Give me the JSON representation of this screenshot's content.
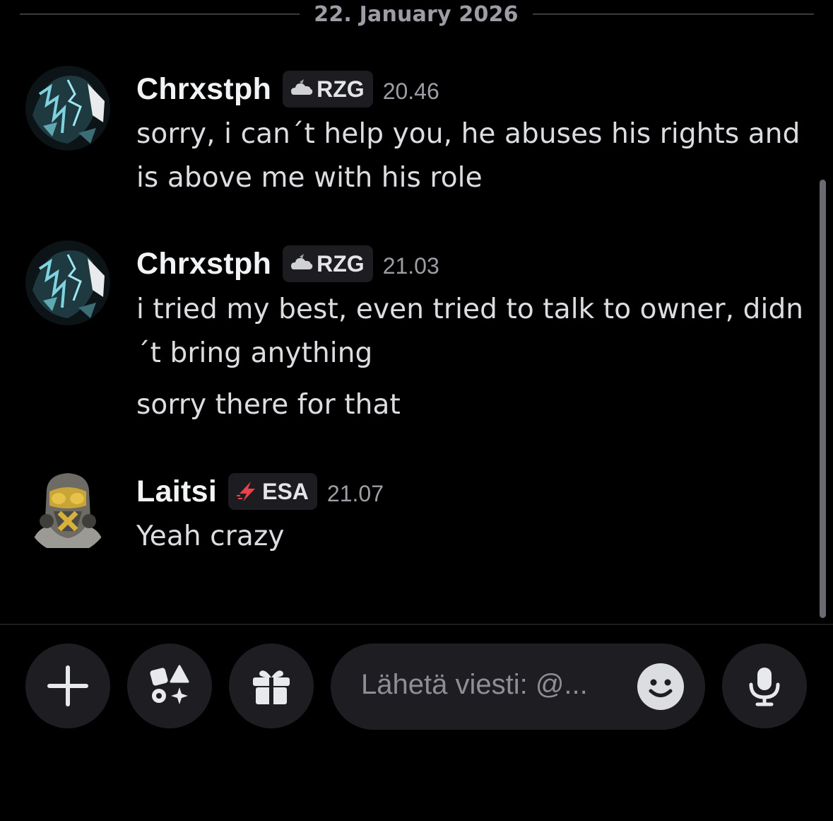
{
  "date_divider": "22. January 2026",
  "messages": [
    {
      "username": "Chrxstph",
      "tag": "RZG",
      "time": "20.46",
      "lines": [
        "sorry, i can´t help you, he abuses his rights and is above me with his role"
      ]
    },
    {
      "username": "Chrxstph",
      "tag": "RZG",
      "time": "21.03",
      "lines": [
        "i tried my best, even tried to talk to owner, didn´t bring anything",
        "sorry there for that"
      ]
    },
    {
      "username": "Laitsi",
      "tag": "ESA",
      "time": "21.07",
      "lines": [
        "Yeah crazy"
      ]
    }
  ],
  "composer": {
    "placeholder": "Lähetä viesti: @...",
    "buttons": [
      "plus-icon",
      "apps-icon",
      "gift-icon",
      "emoji-icon",
      "microphone-icon"
    ]
  },
  "colors": {
    "background": "#000000",
    "surface": "#1d1d22",
    "muted_text": "#9d9da6",
    "body_text": "#dcdde0",
    "esa_bolt": "#e8434a"
  }
}
